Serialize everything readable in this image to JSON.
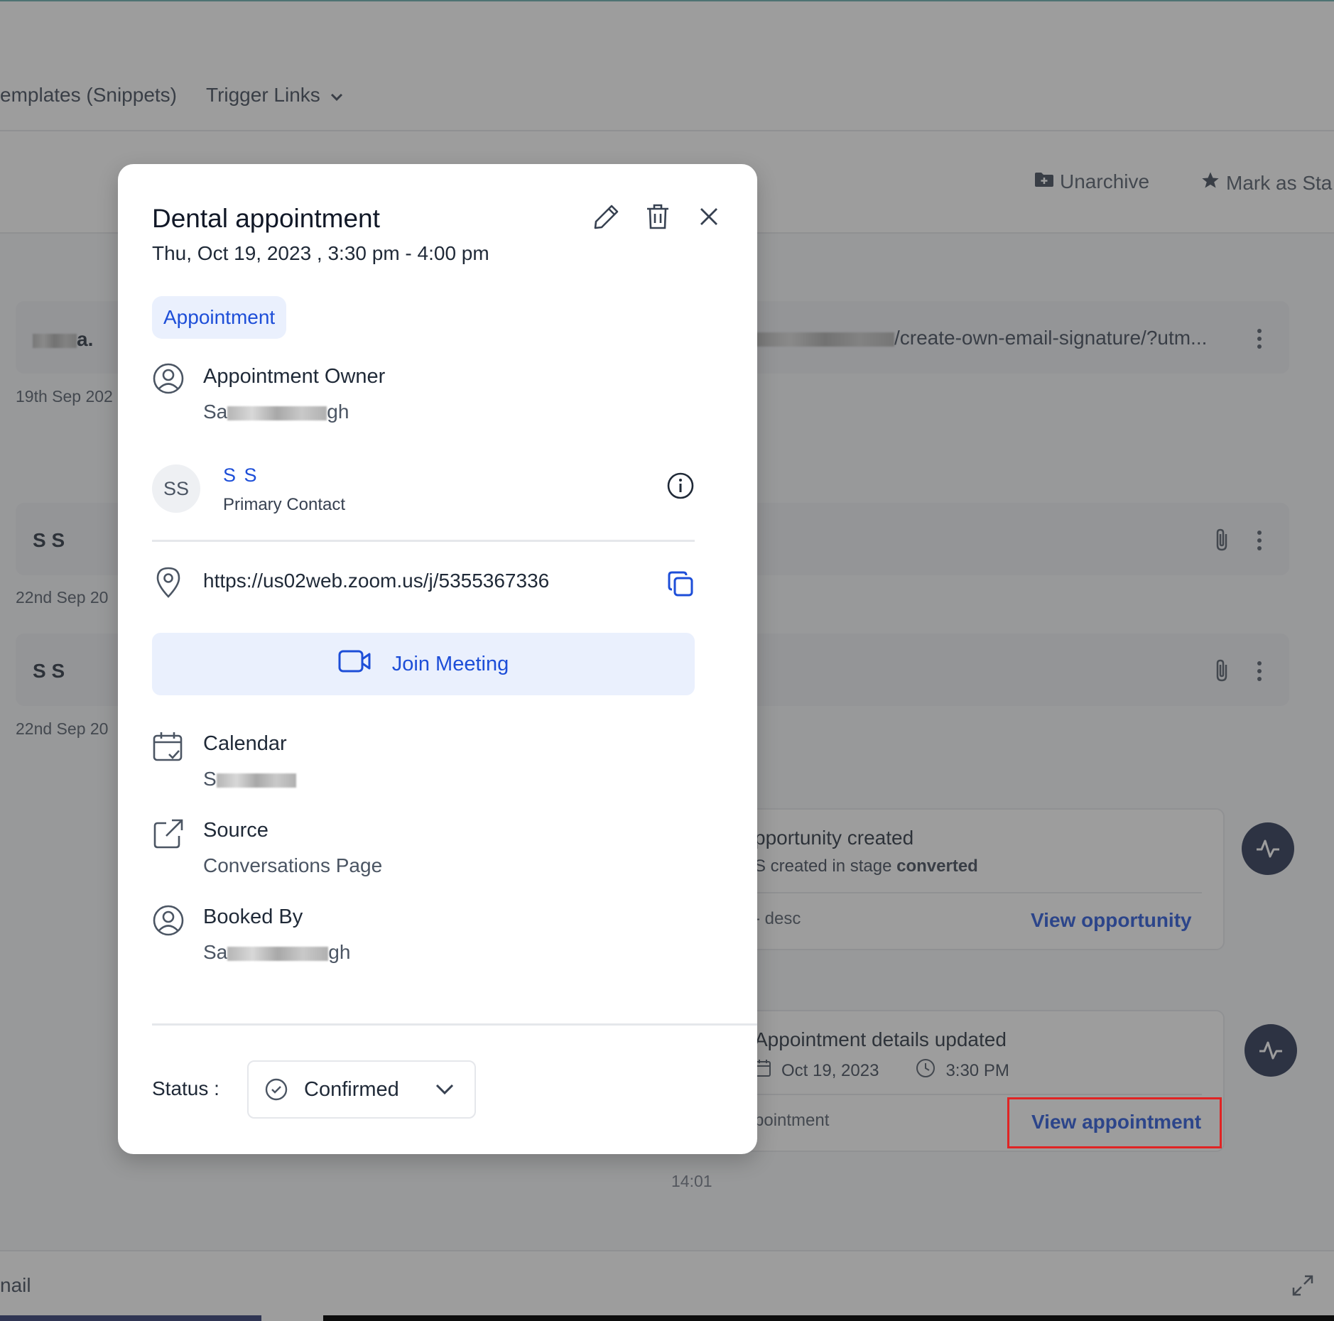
{
  "background": {
    "top_nav": {
      "snippets": "emplates (Snippets)",
      "trigger_links": "Trigger Links"
    },
    "actions": {
      "unarchive": "Unarchive",
      "mark_as_starred": "Mark as Sta"
    },
    "messages": [
      {
        "sender": "a.",
        "date": "19th Sep 202",
        "preview": "/create-own-email-signature/?utm..."
      },
      {
        "sender": "S S",
        "date": "22nd Sep 20"
      },
      {
        "sender": "S S",
        "date": "22nd Sep 20"
      }
    ],
    "activity_opportunity": {
      "title": "pportunity created",
      "subtitle_prefix": "S created in stage ",
      "subtitle_stage": "converted",
      "footer_left": "- desc",
      "link": "View opportunity"
    },
    "activity_appointment": {
      "title": "Appointment details updated",
      "date": "Oct 19, 2023",
      "time": "3:30 PM",
      "footer_left": "pointment",
      "link": "View appointment"
    },
    "timestamp": "14:01",
    "composer_label": "nail"
  },
  "modal": {
    "title": "Dental appointment",
    "datetime": "Thu, Oct 19, 2023 , 3:30 pm - 4:00 pm",
    "tag": "Appointment",
    "owner": {
      "label": "Appointment Owner",
      "value_start": "Sa",
      "value_end": "gh"
    },
    "contact": {
      "initials": "SS",
      "name": "S S",
      "role": "Primary Contact"
    },
    "location": {
      "url": "https://us02web.zoom.us/j/5355367336"
    },
    "join_button": "Join Meeting",
    "calendar": {
      "label": "Calendar",
      "value_start": "S"
    },
    "source": {
      "label": "Source",
      "value": "Conversations Page"
    },
    "booked_by": {
      "label": "Booked By",
      "value_start": "Sa",
      "value_end": "gh"
    },
    "status": {
      "label": "Status :",
      "value": "Confirmed"
    }
  },
  "colors": {
    "accent": "#1d4ed8",
    "accent_bg": "#eaf0fd",
    "highlight_box": "#e02424",
    "activity_icon_bg": "#1e2a4a"
  }
}
